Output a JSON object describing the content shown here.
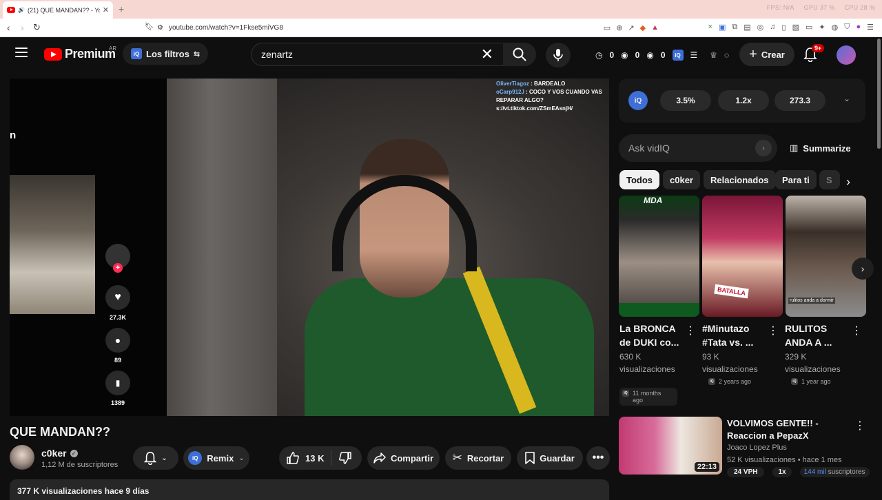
{
  "browser": {
    "tab_title": "(21) QUE MANDAN?? - YouTu",
    "url": "youtube.com/watch?v=1Fkse5miVG8",
    "sys_stats": [
      "FPS: N/A",
      "GPU 37 %",
      "CPU 28 %"
    ]
  },
  "header": {
    "logo_text": "Premium",
    "country": "AR",
    "filters_label": "Los filtros",
    "search_value": "zenartz",
    "counters": [
      "0",
      "0",
      "0"
    ],
    "create_label": "Crear",
    "notif_badge": "9+"
  },
  "video": {
    "tiktok_letter": "n",
    "tiktok_likes": "27.3K",
    "tiktok_comments": "89",
    "tiktok_saves": "1389",
    "chat": [
      {
        "user": "OliverTiagoz",
        "text": " : BARDEALO"
      },
      {
        "user": "oCarp912J",
        "text": " : COCO Y VOS CUANDO VAS REPARAR ALGO?"
      },
      {
        "user": "",
        "text": "s://vt.tiktok.com/ZSmEAsnjH/"
      }
    ]
  },
  "meta": {
    "title": "QUE MANDAN??",
    "channel": "c0ker",
    "subscribers": "1,12 M de suscriptores",
    "remix_label": "Remix",
    "likes": "13 K",
    "share_label": "Compartir",
    "clip_label": "Recortar",
    "save_label": "Guardar",
    "views_date": "377 K visualizaciones  hace 9 días"
  },
  "sidebar": {
    "vidiq_stats": [
      "3.5%",
      "1.2x",
      "273.3"
    ],
    "ask_placeholder": "Ask vidIQ",
    "summarize_label": "Summarize",
    "chips": [
      "Todos",
      "c0ker",
      "Relacionados",
      "Para ti",
      "S"
    ],
    "cards": [
      {
        "title": "La BRONCA de DUKI co...",
        "views": "630 K",
        "views_label": "visualizaciones",
        "ago": "11 months ago",
        "thumb_label": "MDA"
      },
      {
        "title": "#Minutazo #Tata vs. ...",
        "views": "93 K",
        "views_label": "visualizaciones",
        "ago": "2 years ago",
        "thumb_label": "BATALLA"
      },
      {
        "title": "RULITOS ANDA A ...",
        "views": "329 K",
        "views_label": "visualizaciones",
        "ago": "1 year ago",
        "thumb_label": "rulitos anda a dormir"
      }
    ],
    "list_item": {
      "title": "VOLVIMOS GENTE!! - Reaccion a PepazX",
      "channel": "Joaco Lopez Plus",
      "meta": "52 K visualizaciones • hace 1 mes",
      "duration": "22:13",
      "vph": "24 VPH",
      "ratio": "1x",
      "subs_num": "144 mil",
      "subs_label": "suscriptores"
    }
  }
}
